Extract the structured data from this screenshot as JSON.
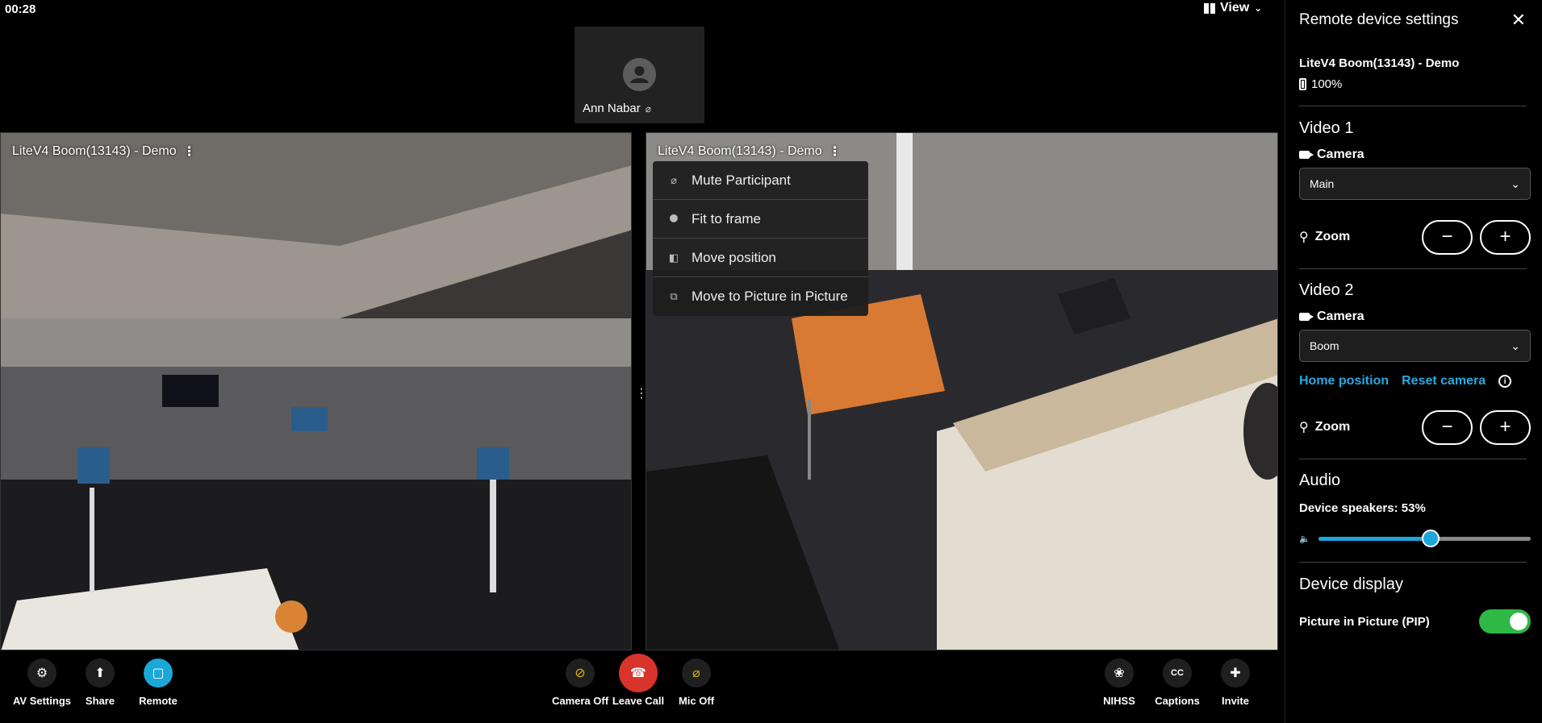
{
  "header": {
    "timer": "00:28",
    "view_label": "View"
  },
  "participant": {
    "name": "Ann Nabar"
  },
  "videos": [
    {
      "label": "LiteV4 Boom(13143) - Demo"
    },
    {
      "label": "LiteV4 Boom(13143) - Demo"
    }
  ],
  "context_menu": {
    "items": [
      {
        "label": "Mute Participant",
        "icon": "mic-off-icon"
      },
      {
        "label": "Fit to frame",
        "icon": "fit-frame-icon"
      },
      {
        "label": "Move position",
        "icon": "move-position-icon"
      },
      {
        "label": "Move to Picture in Picture",
        "icon": "pip-icon"
      }
    ]
  },
  "toolbar": {
    "av_settings": "AV Settings",
    "share": "Share",
    "remote": "Remote",
    "camera_off": "Camera Off",
    "leave_call": "Leave Call",
    "mic_off": "Mic Off",
    "nihss": "NIHSS",
    "captions": "Captions",
    "invite": "Invite"
  },
  "panel": {
    "title": "Remote device settings",
    "device_name": "LiteV4 Boom(13143) - Demo",
    "battery": "100%",
    "video1": {
      "title": "Video 1",
      "camera_label": "Camera",
      "camera_value": "Main",
      "zoom_label": "Zoom"
    },
    "video2": {
      "title": "Video 2",
      "camera_label": "Camera",
      "camera_value": "Boom",
      "home_position": "Home position",
      "reset_camera": "Reset camera",
      "zoom_label": "Zoom"
    },
    "audio": {
      "title": "Audio",
      "speakers_label": "Device speakers: 53%",
      "speakers_value": 53
    },
    "display": {
      "title": "Device display",
      "pip_label": "Picture in Picture (PIP)",
      "pip_on": true
    }
  },
  "colors": {
    "accent": "#1ba8d9",
    "leave": "#d8342b",
    "toggle_on": "#2eb845",
    "link": "#29a8e0"
  }
}
